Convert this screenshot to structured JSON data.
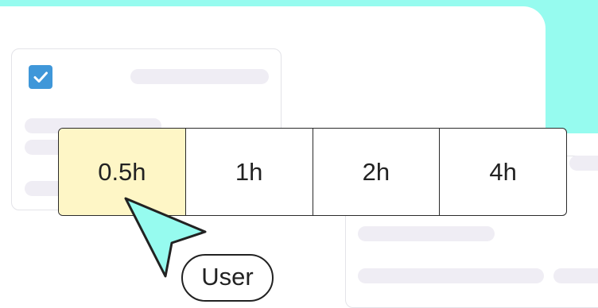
{
  "time_selector": {
    "options": [
      "0.5h",
      "1h",
      "2h",
      "4h"
    ],
    "selected": "0.5h"
  },
  "cursor_label": "User",
  "colors": {
    "background": "#96fbef",
    "selected_option": "#fef6c6",
    "checkbox": "#3f97d9",
    "cursor_fill": "#96fbef",
    "placeholder_bar": "#efedf4"
  },
  "icons": {
    "checkbox": "check-icon",
    "pointer": "cursor-arrow-icon"
  }
}
